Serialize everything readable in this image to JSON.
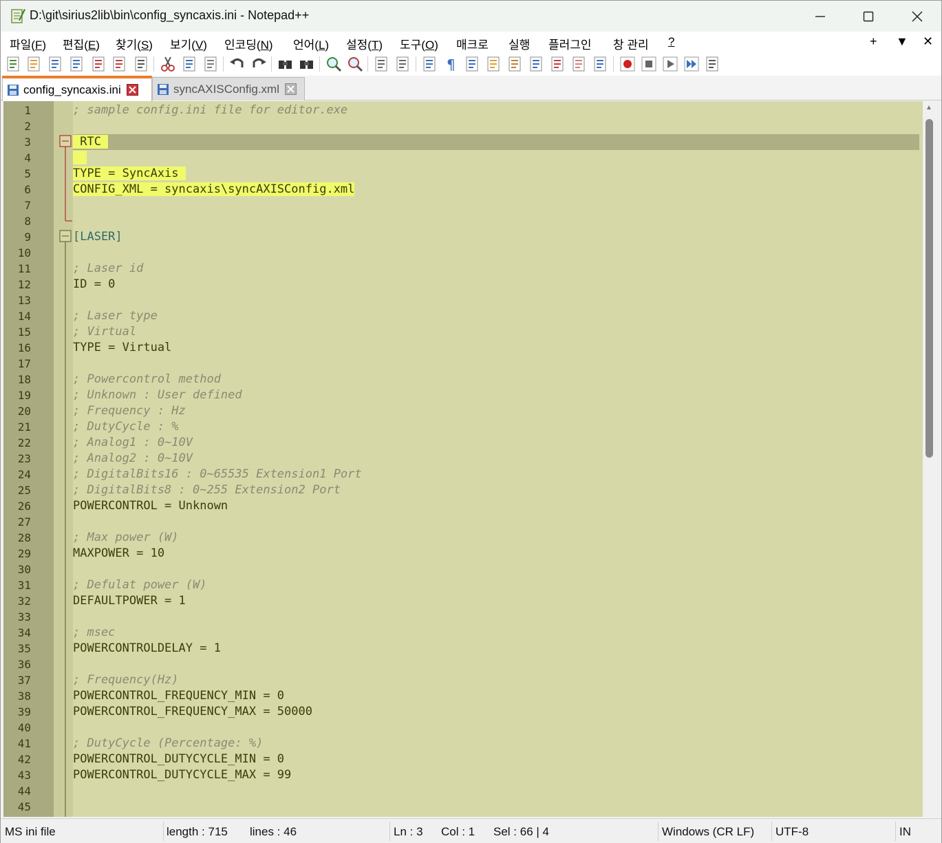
{
  "window": {
    "title": "D:\\git\\sirius2lib\\bin\\config_syncaxis.ini - Notepad++"
  },
  "menu": [
    {
      "pre": "파일(",
      "key": "F",
      "post": ")"
    },
    {
      "pre": "편집(",
      "key": "E",
      "post": ")"
    },
    {
      "pre": "찾기(",
      "key": "S",
      "post": ")"
    },
    {
      "pre": "보기(",
      "key": "V",
      "post": ")"
    },
    {
      "pre": "인코딩(",
      "key": "N",
      "post": ")"
    },
    {
      "pre": "언어(",
      "key": "L",
      "post": ")"
    },
    {
      "pre": "설정(",
      "key": "T",
      "post": ")"
    },
    {
      "pre": "도구(",
      "key": "O",
      "post": ")"
    },
    {
      "pre": "매크로",
      "key": "",
      "post": ""
    },
    {
      "pre": "실행",
      "key": "",
      "post": ""
    },
    {
      "pre": "플러그인",
      "key": "",
      "post": ""
    },
    {
      "pre": "창 관리",
      "key": "",
      "post": ""
    },
    {
      "pre": "",
      "key": "?",
      "post": ""
    }
  ],
  "menu_right": {
    "plus": "+",
    "down": "▼",
    "close": "✕"
  },
  "toolbar_icons": [
    "new-file-icon",
    "open-file-icon",
    "save-icon",
    "save-all-icon",
    "close-icon",
    "close-all-icon",
    "print-icon",
    "cut-icon",
    "copy-icon",
    "paste-icon",
    "undo-icon",
    "redo-icon",
    "find-icon",
    "replace-icon",
    "zoom-in-icon",
    "zoom-out-icon",
    "sync-vertical-icon",
    "sync-horizontal-icon",
    "word-wrap-icon",
    "show-all-chars-icon",
    "indent-guide-icon",
    "udl-icon",
    "doc-map-icon",
    "doc-list-icon",
    "function-list-icon",
    "folder-workspace-icon",
    "monitoring-icon",
    "record-macro-icon",
    "stop-record-icon",
    "play-macro-icon",
    "run-macro-multiple-icon",
    "save-macro-icon"
  ],
  "tabs": [
    {
      "label": "config_syncaxis.ini",
      "active": true
    },
    {
      "label": "syncAXISConfig.xml",
      "active": false
    }
  ],
  "lines": [
    {
      "n": "1",
      "segs": [
        {
          "t": "; sample config.ini file for editor.exe",
          "c": "c-comment"
        }
      ]
    },
    {
      "n": "2",
      "segs": []
    },
    {
      "n": "3",
      "segs": [
        {
          "t": " RTC ",
          "c": "c-key hl-sel"
        }
      ]
    },
    {
      "n": "4",
      "segs": [
        {
          "t": "  ",
          "c": "hl-sel"
        }
      ]
    },
    {
      "n": "5",
      "segs": [
        {
          "t": "TYPE = SyncAxis ",
          "c": "c-key hl-sel"
        }
      ]
    },
    {
      "n": "6",
      "segs": [
        {
          "t": "CONFIG_XML = syncaxis\\syncAXISConfig.xml",
          "c": "c-key hl-sel"
        }
      ]
    },
    {
      "n": "7",
      "segs": []
    },
    {
      "n": "8",
      "segs": []
    },
    {
      "n": "9",
      "segs": [
        {
          "t": "[LASER]",
          "c": "c-section"
        }
      ]
    },
    {
      "n": "10",
      "segs": []
    },
    {
      "n": "11",
      "segs": [
        {
          "t": "; Laser id",
          "c": "c-comment"
        }
      ]
    },
    {
      "n": "12",
      "segs": [
        {
          "t": "ID = 0",
          "c": "c-key"
        }
      ]
    },
    {
      "n": "13",
      "segs": []
    },
    {
      "n": "14",
      "segs": [
        {
          "t": "; Laser type",
          "c": "c-comment"
        }
      ]
    },
    {
      "n": "15",
      "segs": [
        {
          "t": "; Virtual",
          "c": "c-comment"
        }
      ]
    },
    {
      "n": "16",
      "segs": [
        {
          "t": "TYPE = Virtual",
          "c": "c-key"
        }
      ]
    },
    {
      "n": "17",
      "segs": []
    },
    {
      "n": "18",
      "segs": [
        {
          "t": "; Powercontrol method",
          "c": "c-comment"
        }
      ]
    },
    {
      "n": "19",
      "segs": [
        {
          "t": "; Unknown : User defined",
          "c": "c-comment"
        }
      ]
    },
    {
      "n": "20",
      "segs": [
        {
          "t": "; Frequency : Hz",
          "c": "c-comment"
        }
      ]
    },
    {
      "n": "21",
      "segs": [
        {
          "t": "; DutyCycle : %",
          "c": "c-comment"
        }
      ]
    },
    {
      "n": "22",
      "segs": [
        {
          "t": "; Analog1 : 0~10V",
          "c": "c-comment"
        }
      ]
    },
    {
      "n": "23",
      "segs": [
        {
          "t": "; Analog2 : 0~10V",
          "c": "c-comment"
        }
      ]
    },
    {
      "n": "24",
      "segs": [
        {
          "t": "; DigitalBits16 : 0~65535 Extension1 Port",
          "c": "c-comment"
        }
      ]
    },
    {
      "n": "25",
      "segs": [
        {
          "t": "; DigitalBits8 : 0~255 Extension2 Port",
          "c": "c-comment"
        }
      ]
    },
    {
      "n": "26",
      "segs": [
        {
          "t": "POWERCONTROL = Unknown",
          "c": "c-key"
        }
      ]
    },
    {
      "n": "27",
      "segs": []
    },
    {
      "n": "28",
      "segs": [
        {
          "t": "; Max power (W)",
          "c": "c-comment"
        }
      ]
    },
    {
      "n": "29",
      "segs": [
        {
          "t": "MAXPOWER = 10",
          "c": "c-key"
        }
      ]
    },
    {
      "n": "30",
      "segs": []
    },
    {
      "n": "31",
      "segs": [
        {
          "t": "; Defulat power (W)",
          "c": "c-comment"
        }
      ]
    },
    {
      "n": "32",
      "segs": [
        {
          "t": "DEFAULTPOWER = 1",
          "c": "c-key"
        }
      ]
    },
    {
      "n": "33",
      "segs": []
    },
    {
      "n": "34",
      "segs": [
        {
          "t": "; msec",
          "c": "c-comment"
        }
      ]
    },
    {
      "n": "35",
      "segs": [
        {
          "t": "POWERCONTROLDELAY = 1",
          "c": "c-key"
        }
      ]
    },
    {
      "n": "36",
      "segs": []
    },
    {
      "n": "37",
      "segs": [
        {
          "t": "; Frequency(Hz)",
          "c": "c-comment"
        }
      ]
    },
    {
      "n": "38",
      "segs": [
        {
          "t": "POWERCONTROL_FREQUENCY_MIN = 0",
          "c": "c-key"
        }
      ]
    },
    {
      "n": "39",
      "segs": [
        {
          "t": "POWERCONTROL_FREQUENCY_MAX = 50000",
          "c": "c-key"
        }
      ]
    },
    {
      "n": "40",
      "segs": []
    },
    {
      "n": "41",
      "segs": [
        {
          "t": "; DutyCycle (Percentage: %)",
          "c": "c-comment"
        }
      ]
    },
    {
      "n": "42",
      "segs": [
        {
          "t": "POWERCONTROL_DUTYCYCLE_MIN = 0",
          "c": "c-key"
        }
      ]
    },
    {
      "n": "43",
      "segs": [
        {
          "t": "POWERCONTROL_DUTYCYCLE_MAX = 99",
          "c": "c-key"
        }
      ]
    },
    {
      "n": "44",
      "segs": []
    },
    {
      "n": "45",
      "segs": []
    }
  ],
  "status": {
    "file_type": "MS ini file",
    "length": "length : 715",
    "lines": "lines : 46",
    "ln": "Ln : 3",
    "col": "Col : 1",
    "sel": "Sel : 66 | 4",
    "eol": "Windows (CR LF)",
    "encoding": "UTF-8",
    "mode": "IN"
  },
  "colors": {
    "editor_bg": "#d7d8a8",
    "gutter_bg": "#a9aa7f",
    "current_line": "#aeaf84",
    "selection": "#f0fa6a",
    "tab_accent": "#ea7d2b"
  }
}
